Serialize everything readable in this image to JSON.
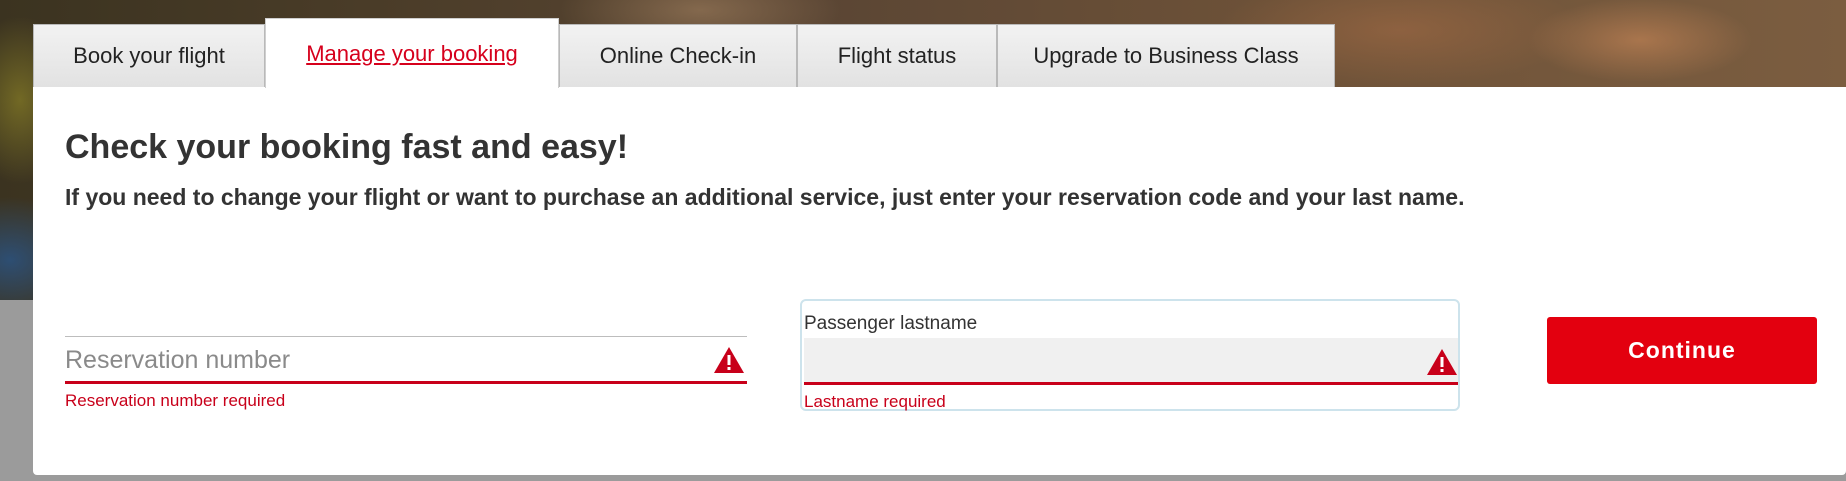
{
  "tabs": [
    {
      "label": "Book your flight",
      "active": false
    },
    {
      "label": "Manage your booking",
      "active": true
    },
    {
      "label": "Online Check-in",
      "active": false
    },
    {
      "label": "Flight status",
      "active": false
    },
    {
      "label": "Upgrade to Business Class",
      "active": false
    }
  ],
  "main": {
    "heading": "Check your booking fast and easy!",
    "subheading": "If you need to change your flight or want to purchase an additional service, just enter your reservation code and your last name."
  },
  "form": {
    "reservation": {
      "placeholder": "Reservation number",
      "value": "",
      "error": "Reservation number required"
    },
    "lastname": {
      "label": "Passenger lastname",
      "value": "",
      "error": "Lastname required"
    },
    "continue_label": "Continue"
  },
  "icons": {
    "field_error": "warning-triangle-icon"
  },
  "colors": {
    "accent": "#e3000f",
    "error": "#c8001a",
    "active_tab_text": "#d6001c"
  }
}
